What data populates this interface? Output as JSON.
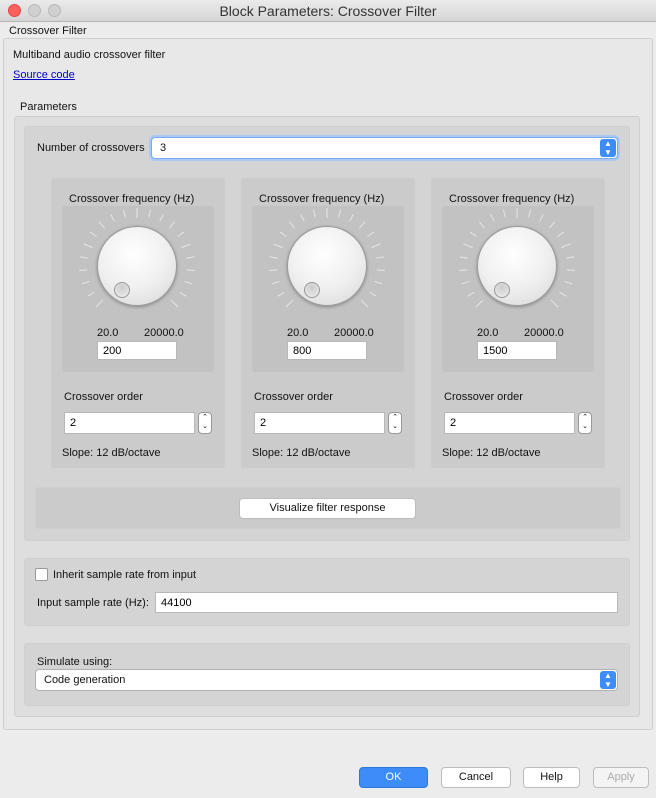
{
  "window": {
    "title": "Block Parameters: Crossover Filter"
  },
  "block_name": "Crossover Filter",
  "description": "Multiband audio crossover filter",
  "source_link": "Source code",
  "parameters_label": "Parameters",
  "num_crossovers": {
    "label": "Number of crossovers",
    "value": "3"
  },
  "crossovers": [
    {
      "freq_label": "Crossover frequency (Hz)",
      "min": "20.0",
      "max": "20000.0",
      "freq": "200",
      "order_label": "Crossover order",
      "order": "2",
      "slope": "Slope: 12 dB/octave"
    },
    {
      "freq_label": "Crossover frequency (Hz)",
      "min": "20.0",
      "max": "20000.0",
      "freq": "800",
      "order_label": "Crossover order",
      "order": "2",
      "slope": "Slope: 12 dB/octave"
    },
    {
      "freq_label": "Crossover frequency (Hz)",
      "min": "20.0",
      "max": "20000.0",
      "freq": "1500",
      "order_label": "Crossover order",
      "order": "2",
      "slope": "Slope: 12 dB/octave"
    }
  ],
  "visualize_button": "Visualize filter response",
  "inherit_checkbox": {
    "label": "Inherit sample rate from input",
    "checked": false
  },
  "sample_rate": {
    "label": "Input sample rate (Hz):",
    "value": "44100"
  },
  "simulate": {
    "label": "Simulate using:",
    "value": "Code generation"
  },
  "buttons": {
    "ok": "OK",
    "cancel": "Cancel",
    "help": "Help",
    "apply": "Apply"
  },
  "colors": {
    "accent": "#3d8cf7",
    "close": "#fc605c"
  }
}
